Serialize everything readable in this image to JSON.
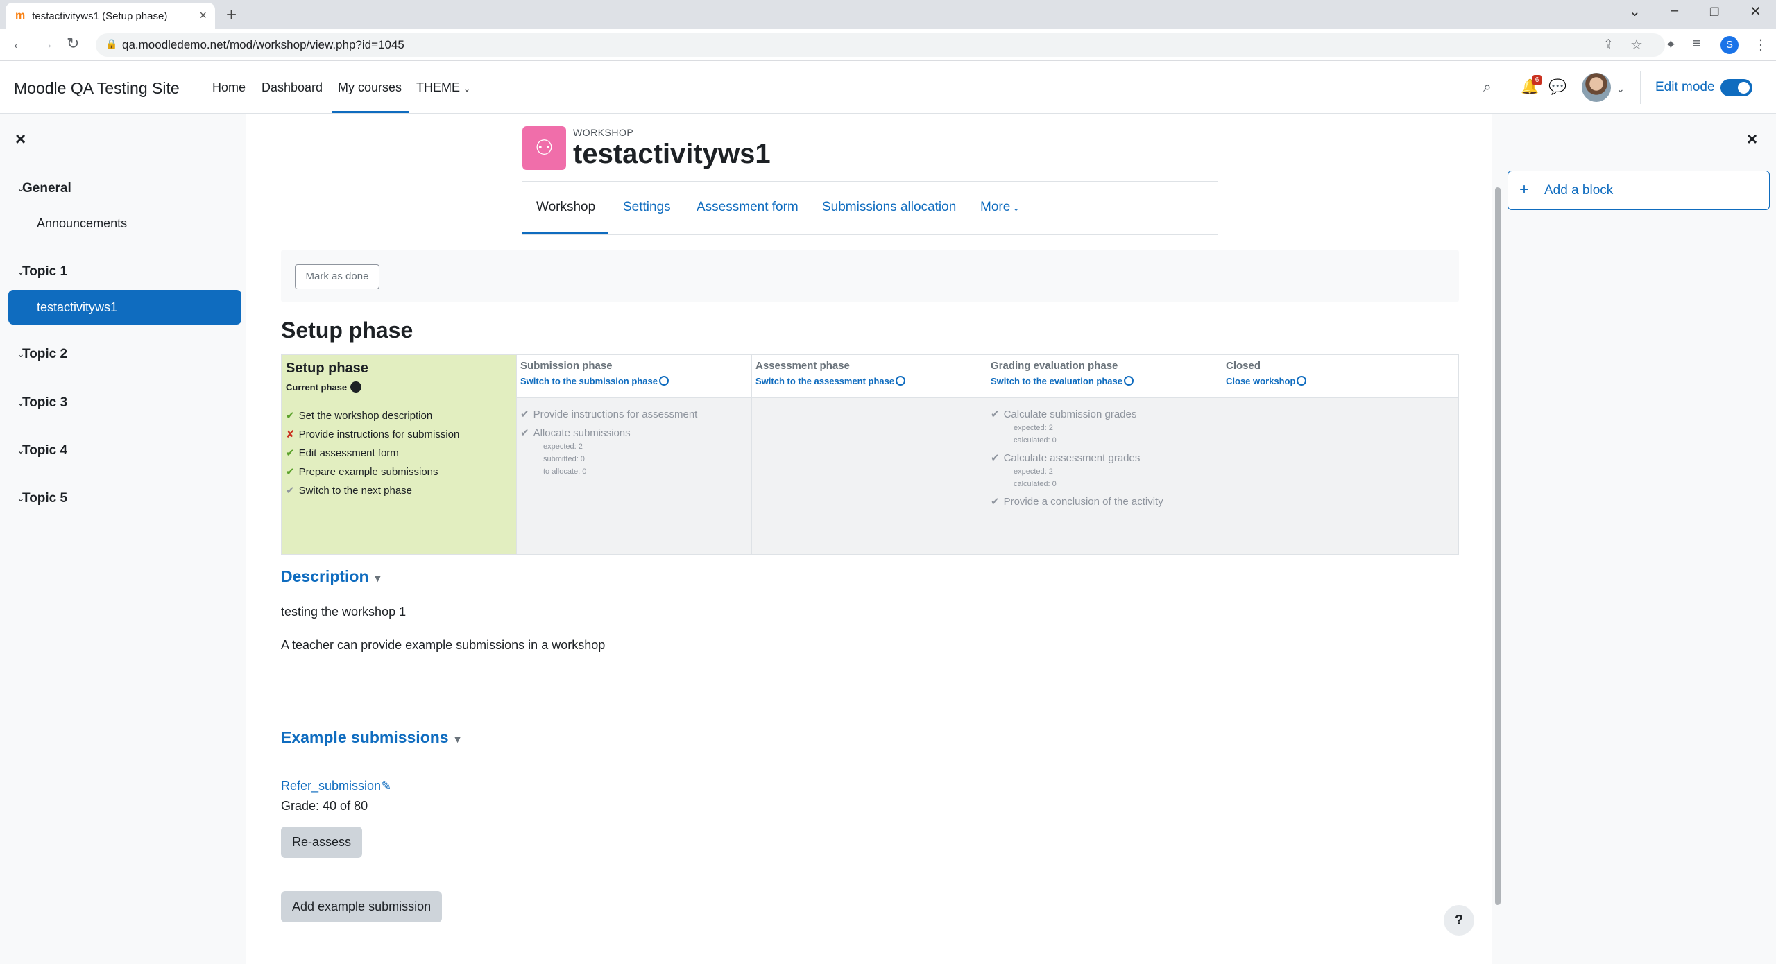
{
  "browser": {
    "tab_title": "testactivityws1 (Setup phase)",
    "url": "qa.moodledemo.net/mod/workshop/view.php?id=1045",
    "profile_initial": "S"
  },
  "nav": {
    "site_name": "Moodle QA Testing Site",
    "links": [
      "Home",
      "Dashboard",
      "My courses",
      "THEME"
    ],
    "active_link": "My courses",
    "notification_count": "6",
    "edit_mode_label": "Edit mode",
    "edit_mode_on": true
  },
  "course_index": {
    "sections": [
      {
        "title": "General",
        "items": [
          "Announcements"
        ]
      },
      {
        "title": "Topic 1",
        "items": [
          "testactivityws1"
        ]
      },
      {
        "title": "Topic 2",
        "items": []
      },
      {
        "title": "Topic 3",
        "items": []
      },
      {
        "title": "Topic 4",
        "items": []
      },
      {
        "title": "Topic 5",
        "items": []
      }
    ],
    "selected_item": "testactivityws1"
  },
  "activity": {
    "type_label": "WORKSHOP",
    "title": "testactivityws1",
    "secondary_nav": [
      "Workshop",
      "Settings",
      "Assessment form",
      "Submissions allocation",
      "More"
    ],
    "active_tab": "Workshop",
    "mark_done_label": "Mark as done"
  },
  "phase_heading": "Setup phase",
  "phases": {
    "setup": {
      "name": "Setup phase",
      "current_label": "Current phase",
      "tasks": [
        {
          "label": "Set the workshop description",
          "status": "done"
        },
        {
          "label": "Provide instructions for submission",
          "status": "fail"
        },
        {
          "label": "Edit assessment form",
          "status": "done"
        },
        {
          "label": "Prepare example submissions",
          "status": "done"
        },
        {
          "label": "Switch to the next phase",
          "status": "todo"
        }
      ]
    },
    "submission": {
      "name": "Submission phase",
      "switch_label": "Switch to the submission phase",
      "tasks": [
        {
          "label": "Provide instructions for assessment"
        },
        {
          "label": "Allocate submissions",
          "details": [
            "expected: 2",
            "submitted: 0",
            "to allocate: 0"
          ]
        }
      ]
    },
    "assessment": {
      "name": "Assessment phase",
      "switch_label": "Switch to the assessment phase"
    },
    "grading": {
      "name": "Grading evaluation phase",
      "switch_label": "Switch to the evaluation phase",
      "tasks": [
        {
          "label": "Calculate submission grades",
          "details": [
            "expected: 2",
            "calculated: 0"
          ]
        },
        {
          "label": "Calculate assessment grades",
          "details": [
            "expected: 2",
            "calculated: 0"
          ]
        },
        {
          "label": "Provide a conclusion of the activity"
        }
      ]
    },
    "closed": {
      "name": "Closed",
      "switch_label": "Close workshop"
    }
  },
  "description": {
    "heading": "Description",
    "paragraphs": [
      "testing the workshop 1",
      "A teacher can provide example submissions in a workshop"
    ]
  },
  "examples": {
    "heading": "Example submissions",
    "submission_link": "Refer_submission",
    "grade": "Grade: 40 of 80",
    "reassess_label": "Re-assess",
    "add_label": "Add example submission"
  },
  "blocks": {
    "add_block_label": "Add a block"
  },
  "help_label": "?"
}
